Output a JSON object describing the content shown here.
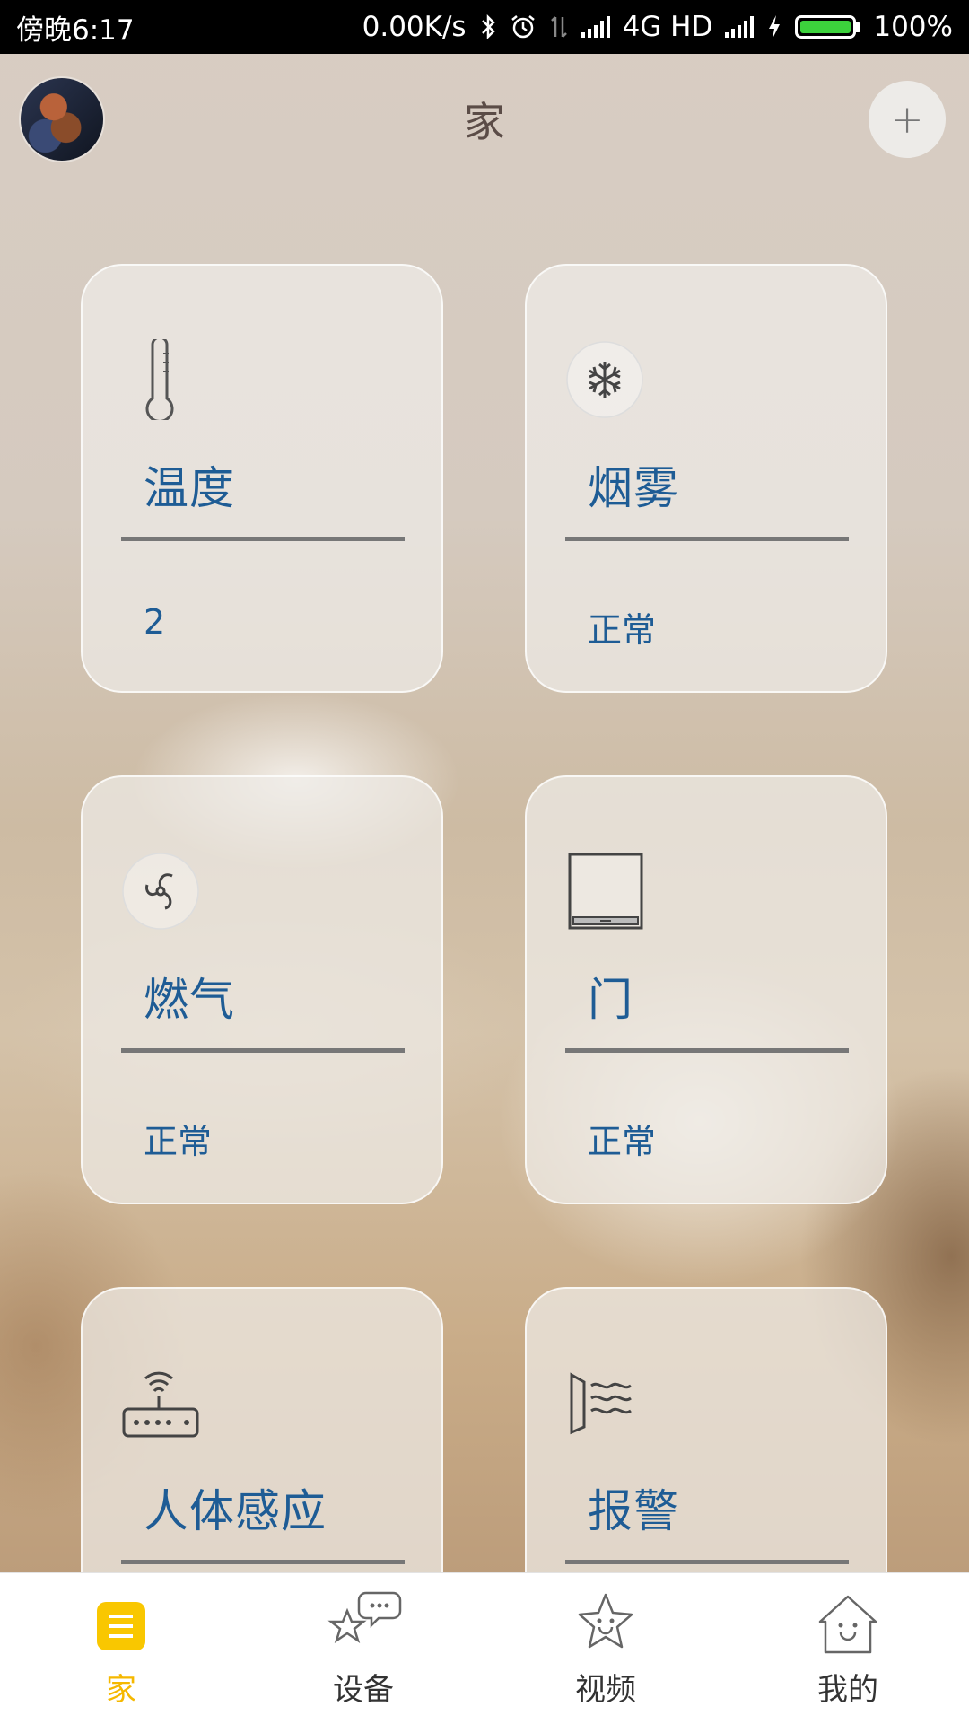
{
  "status_bar": {
    "time": "傍晚6:17",
    "net_speed": "0.00K/s",
    "network": "4G HD",
    "battery": "100%"
  },
  "header": {
    "title": "家",
    "add_label": "+"
  },
  "cards": [
    {
      "title": "温度",
      "value": "2",
      "icon": "thermometer-icon"
    },
    {
      "title": "烟雾",
      "value": "正常",
      "icon": "snowflake-icon"
    },
    {
      "title": "燃气",
      "value": "正常",
      "icon": "fan-icon"
    },
    {
      "title": "门",
      "value": "正常",
      "icon": "door-icon"
    },
    {
      "title": "人体感应",
      "value": "",
      "icon": "router-wifi-icon"
    },
    {
      "title": "报警",
      "value": "",
      "icon": "alarm-waves-icon"
    }
  ],
  "tabs": [
    {
      "label": "家",
      "icon": "home-menu-icon",
      "active": true
    },
    {
      "label": "设备",
      "icon": "device-chat-icon",
      "active": false
    },
    {
      "label": "视频",
      "icon": "video-star-icon",
      "active": false
    },
    {
      "label": "我的",
      "icon": "house-face-icon",
      "active": false
    }
  ],
  "colors": {
    "accent_blue": "#1e5c95",
    "active_tab": "#f5b800",
    "battery_green": "#3cd13c"
  }
}
